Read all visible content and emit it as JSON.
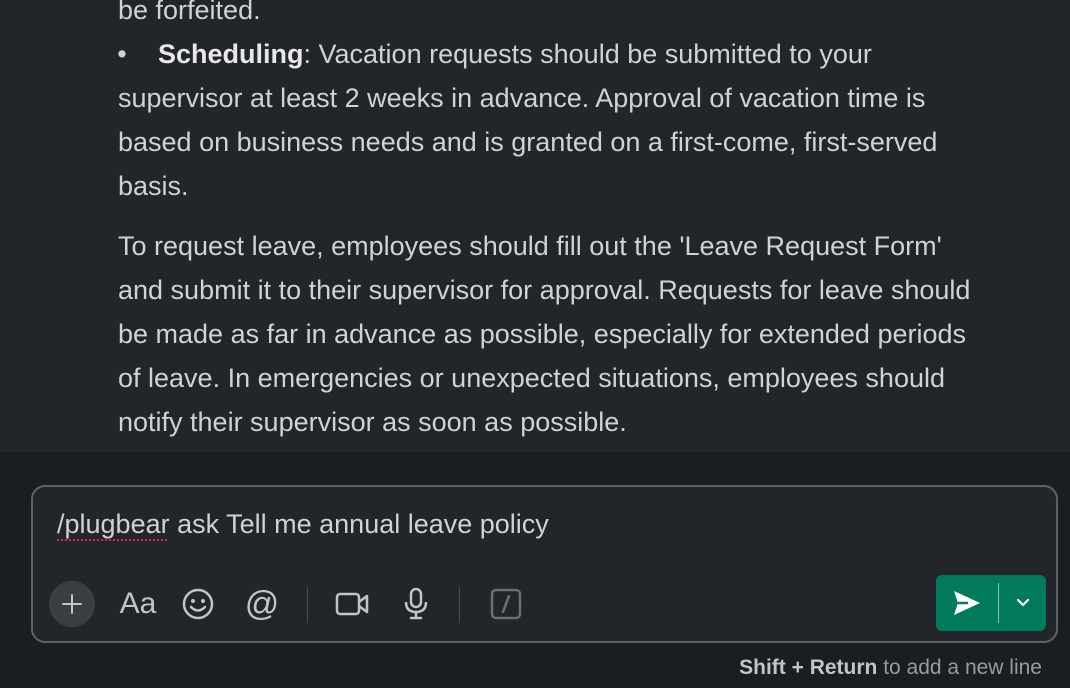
{
  "message": {
    "top_line": "be forfeited.",
    "bullet": {
      "marker": "•",
      "title": "Scheduling",
      "line1": ": Vacation requests should be submitted to your",
      "line2": "supervisor at least 2 weeks in advance. Approval of vacation time is",
      "line3": "based on business needs and is granted on a first-come, first-served",
      "line4": "basis."
    },
    "paragraph": {
      "line1": "To request leave, employees should fill out the 'Leave Request Form'",
      "line2": "and submit it to their supervisor for approval. Requests for leave should",
      "line3": "be made as far in advance as possible, especially for extended periods",
      "line4": "of leave. In emergencies or unexpected situations, employees should",
      "line5": "notify their supervisor as soon as possible."
    }
  },
  "composer": {
    "command": "/plugbear",
    "input_rest": " ask Tell me annual leave policy",
    "toolbar": {
      "plus_icon": "plus-icon",
      "format_label": "Aa",
      "emoji_icon": "emoji-icon",
      "mention_label": "@",
      "video_icon": "video-icon",
      "mic_icon": "microphone-icon",
      "shortcut_icon": "slash-command-icon"
    },
    "send_color": "#007a5a"
  },
  "hint": {
    "keys": "Shift + Return",
    "text": " to add a new line"
  }
}
